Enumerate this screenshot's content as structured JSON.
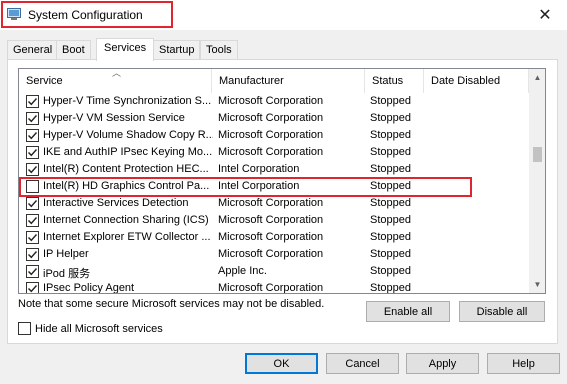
{
  "window": {
    "title": "System Configuration",
    "close_label": "✕"
  },
  "tabs": [
    {
      "label": "General"
    },
    {
      "label": "Boot"
    },
    {
      "label": "Services"
    },
    {
      "label": "Startup"
    },
    {
      "label": "Tools"
    }
  ],
  "active_tab": "Services",
  "columns": {
    "service": "Service",
    "manufacturer": "Manufacturer",
    "status": "Status",
    "date_disabled": "Date Disabled"
  },
  "rows": [
    {
      "checked": true,
      "service": "Hyper-V Time Synchronization S...",
      "manufacturer": "Microsoft Corporation",
      "status": "Stopped"
    },
    {
      "checked": true,
      "service": "Hyper-V VM Session Service",
      "manufacturer": "Microsoft Corporation",
      "status": "Stopped"
    },
    {
      "checked": true,
      "service": "Hyper-V Volume Shadow Copy R...",
      "manufacturer": "Microsoft Corporation",
      "status": "Stopped"
    },
    {
      "checked": true,
      "service": "IKE and AuthIP IPsec Keying Mo...",
      "manufacturer": "Microsoft Corporation",
      "status": "Stopped"
    },
    {
      "checked": true,
      "service": "Intel(R) Content Protection HEC...",
      "manufacturer": "Intel Corporation",
      "status": "Stopped"
    },
    {
      "checked": false,
      "service": "Intel(R) HD Graphics Control Pa...",
      "manufacturer": "Intel Corporation",
      "status": "Stopped"
    },
    {
      "checked": true,
      "service": "Interactive Services Detection",
      "manufacturer": "Microsoft Corporation",
      "status": "Stopped"
    },
    {
      "checked": true,
      "service": "Internet Connection Sharing (ICS)",
      "manufacturer": "Microsoft Corporation",
      "status": "Stopped"
    },
    {
      "checked": true,
      "service": "Internet Explorer ETW Collector ...",
      "manufacturer": "Microsoft Corporation",
      "status": "Stopped"
    },
    {
      "checked": true,
      "service": "IP Helper",
      "manufacturer": "Microsoft Corporation",
      "status": "Stopped"
    },
    {
      "checked": true,
      "service": "iPod 服务",
      "manufacturer": "Apple Inc.",
      "status": "Stopped"
    },
    {
      "checked": true,
      "service": "IPsec Policy Agent",
      "manufacturer": "Microsoft Corporation",
      "status": "Stopped"
    }
  ],
  "note": "Note that some secure Microsoft services may not be disabled.",
  "buttons": {
    "enable_all": "Enable all",
    "disable_all": "Disable all",
    "ok": "OK",
    "cancel": "Cancel",
    "apply": "Apply",
    "help": "Help"
  },
  "hide_ms": {
    "label": "Hide all Microsoft services",
    "checked": false
  },
  "colors": {
    "highlight": "#e02430",
    "accent": "#0078d7"
  }
}
